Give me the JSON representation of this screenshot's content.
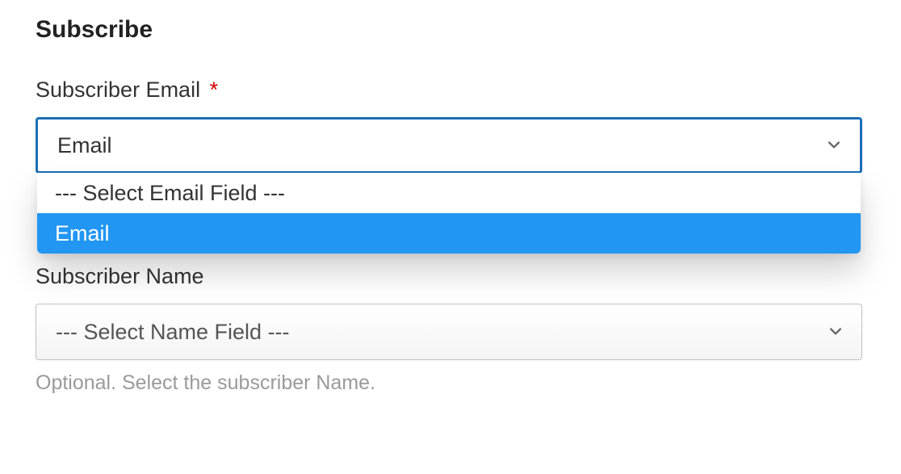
{
  "section": {
    "title": "Subscribe"
  },
  "subscriber_email": {
    "label": "Subscriber Email",
    "required_mark": "*",
    "selected": "Email",
    "dropdown": {
      "option_placeholder": "--- Select Email Field ---",
      "option_email": "Email"
    }
  },
  "subscriber_name": {
    "label": "Subscriber Name",
    "placeholder": "--- Select Name Field ---",
    "help": "Optional. Select the subscriber Name."
  },
  "colors": {
    "focus_border": "#1b6fb8",
    "highlight_bg": "#2196f3",
    "required": "#d40000"
  }
}
